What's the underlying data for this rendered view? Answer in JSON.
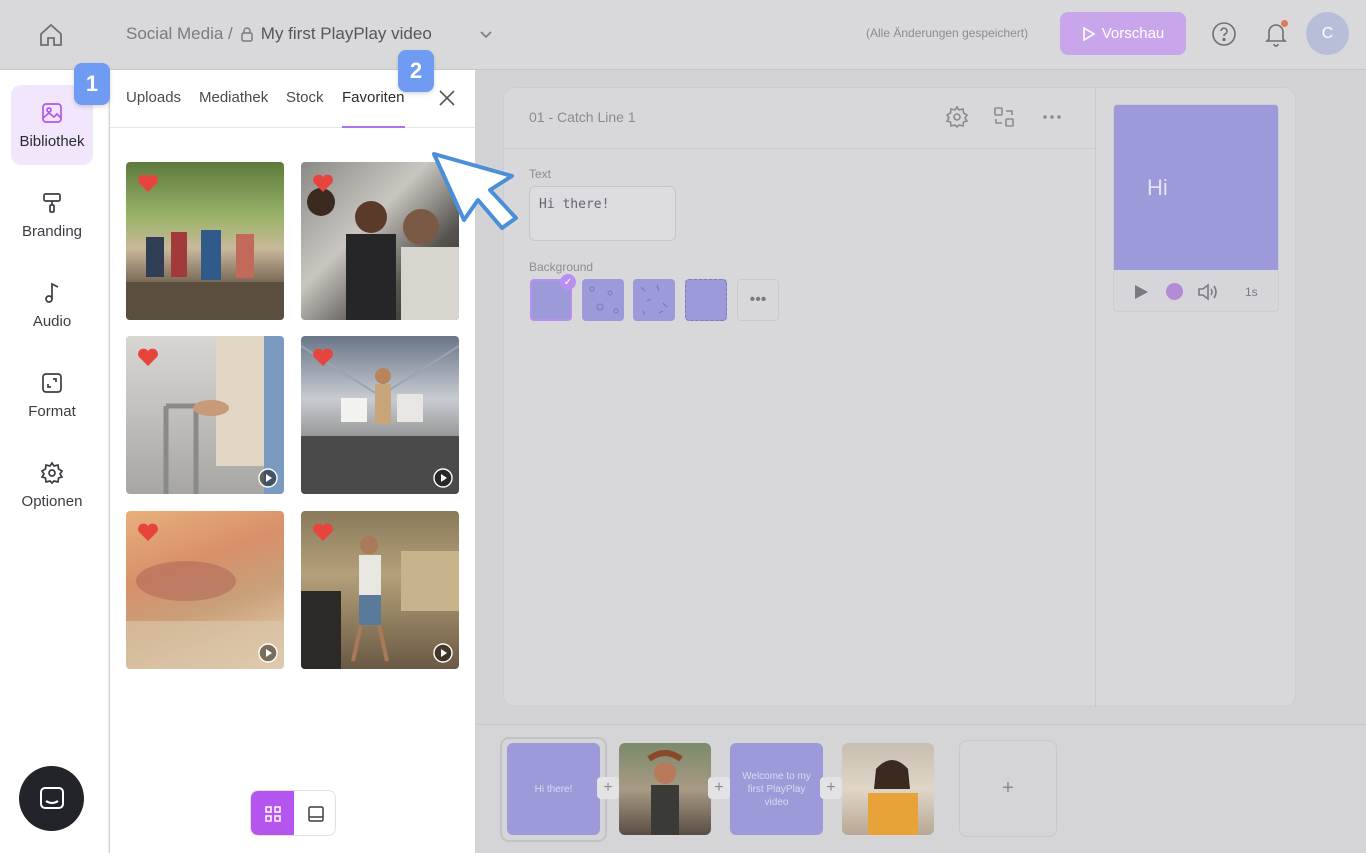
{
  "header": {
    "breadcrumb_parent": "Social Media /",
    "project_title": "My first PlayPlay video",
    "saved_status": "(Alle Änderungen gespeichert)",
    "preview_label": "Vorschau",
    "avatar_initial": "C"
  },
  "rail": {
    "items": [
      {
        "label": "Bibliothek",
        "icon": "image-icon",
        "active": true
      },
      {
        "label": "Branding",
        "icon": "paint-roller-icon",
        "active": false
      },
      {
        "label": "Audio",
        "icon": "music-note-icon",
        "active": false
      },
      {
        "label": "Format",
        "icon": "resize-icon",
        "active": false
      },
      {
        "label": "Optionen",
        "icon": "gear-icon",
        "active": false
      }
    ]
  },
  "badges": {
    "one": "1",
    "two": "2"
  },
  "library": {
    "tabs": [
      "Uploads",
      "Mediathek",
      "Stock",
      "Favoriten"
    ],
    "active_tab": "Favoriten",
    "favorites": [
      {
        "kind": "image",
        "scene": "outdoor-gathering"
      },
      {
        "kind": "image",
        "scene": "office-meeting"
      },
      {
        "kind": "video",
        "scene": "walker-support"
      },
      {
        "kind": "video",
        "scene": "escalator-shopping"
      },
      {
        "kind": "video",
        "scene": "warm-blur"
      },
      {
        "kind": "video",
        "scene": "kitchen-dance"
      }
    ],
    "view_mode": "grid"
  },
  "editor": {
    "scene_title": "01 - Catch Line 1",
    "text_label": "Text",
    "text_value": "Hi there!",
    "background_label": "Background",
    "more_label": "•••",
    "preview_text": "Hi",
    "duration": "1s"
  },
  "timeline": {
    "scenes": [
      {
        "text": "Hi there!"
      },
      {
        "text": ""
      },
      {
        "text": "Welcome to my first PlayPlay video"
      },
      {
        "text": ""
      }
    ],
    "add_label": "+"
  },
  "colors": {
    "accent": "#b355ee",
    "badge": "#6f9bf2",
    "scene_purple": "#9c9ad8",
    "heart": "#e8443e"
  }
}
